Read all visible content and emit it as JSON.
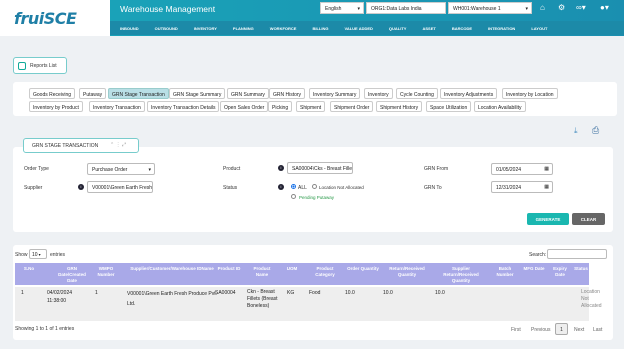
{
  "brand": {
    "logo": "fruiSCE"
  },
  "header": {
    "title": "Warehouse Management",
    "language": "English",
    "org": "ORG1:Data Labs India",
    "warehouse": "WH001:Warehouse 1",
    "user_initial": "T"
  },
  "menu": [
    "INBOUND",
    "OUTBOUND",
    "INVENTORY",
    "PLANNING",
    "WORKFORCE",
    "BILLING",
    "VALUE ADDED",
    "QUALITY",
    "ASSET",
    "BARCODE",
    "INTEGRATION",
    "LAYOUT"
  ],
  "reports_list": "Reports List",
  "tabs_row1": [
    "Goods Receiving",
    "Putaway",
    "GRN Stage Transaction",
    "GRN Stage Summary",
    "GRN Summary",
    "GRN History",
    "Inventory Summary",
    "Inventory",
    "Cycle Counting",
    "Inventory Adjustments",
    "Inventory by Location"
  ],
  "tabs_row2": [
    "Inventory by Product",
    "Inventory Transaction",
    "Inventory Transaction Details",
    "Open Sales Order",
    "Picking",
    "Shipment",
    "Shipment Order",
    "Shipment History",
    "Space Utilization",
    "Location Availability"
  ],
  "filter": {
    "title": "GRN STAGE TRANSACTION",
    "order_type_label": "Order Type",
    "order_type_value": "Purchase Order",
    "supplier_label": "Supplier",
    "supplier_value": "V00001\\Green Earth Fresh",
    "product_label": "Product",
    "product_value": "SA00004\\Cks - Breast Fille",
    "status_label": "Status",
    "status_all": "ALL",
    "status_not_allocated": "Location Not Allocated",
    "status_pending": "Pending Putaway",
    "grn_from_label": "GRN From",
    "grn_from_value": "01/05/2024",
    "grn_to_label": "GRN To",
    "grn_to_value": "12/31/2024",
    "generate": "GENERATE",
    "clear": "CLEAR"
  },
  "table": {
    "show_label": "Show",
    "show_value": "10",
    "entries_label": "entries",
    "search_label": "Search:",
    "columns": [
      "S.No",
      "GRN Date/Created Date",
      "WMPO Number",
      "Supplier/Customer/Warehouse IDName",
      "Product ID",
      "Product Name",
      "UOM",
      "Product Category",
      "Order Quantity",
      "Return/Received Quantity",
      "Supplier Return/Received Quantity",
      "Batch Number",
      "MFG Date",
      "Expiry Date",
      "Status"
    ],
    "rows": [
      {
        "sno": "1",
        "date": "04/02/2024 11:38:00",
        "wmpo": "1",
        "supplier": "V00001\\Green Earth Fresh Produce Pvt. Ltd.",
        "product_id": "SA00004",
        "product_name": "Ckn - Breast Fillets (Breast Boneless)",
        "uom": "KG",
        "category": "Food",
        "order_qty": "10.0",
        "recv_qty": "10.0",
        "supp_qty": "10.0",
        "batch": "",
        "mfg": "",
        "expiry": "",
        "status": "Location Not Allocated"
      }
    ],
    "info": "Showing 1 to 1 of 1 entries",
    "pager": {
      "first": "First",
      "previous": "Previous",
      "current": "1",
      "next": "Next",
      "last": "Last"
    }
  }
}
